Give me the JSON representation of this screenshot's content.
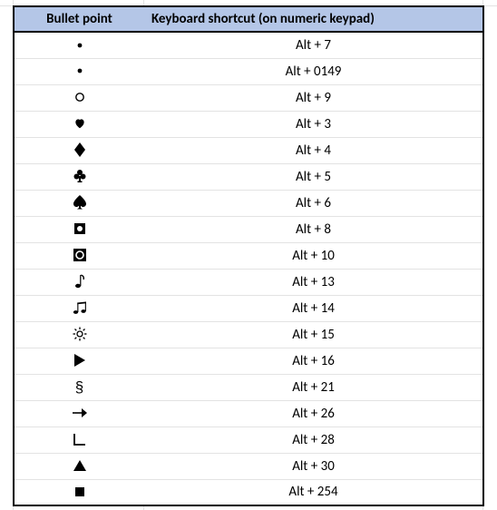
{
  "chart_data": {
    "type": "table",
    "title": "",
    "columns": [
      "Bullet point",
      "Keyboard shortcut (on numeric keypad)"
    ],
    "rows": [
      {
        "symbol_name": "bullet-small",
        "symbol_char": "•",
        "shortcut": "Alt + 7"
      },
      {
        "symbol_name": "bullet-small",
        "symbol_char": "•",
        "shortcut": "Alt + 0149"
      },
      {
        "symbol_name": "circle-outline",
        "symbol_char": "○",
        "shortcut": "Alt + 9"
      },
      {
        "symbol_name": "heart-solid",
        "symbol_char": "♥",
        "shortcut": "Alt + 3"
      },
      {
        "symbol_name": "diamond-solid",
        "symbol_char": "♦",
        "shortcut": "Alt + 4"
      },
      {
        "symbol_name": "club-solid",
        "symbol_char": "♣",
        "shortcut": "Alt + 5"
      },
      {
        "symbol_name": "spade-solid",
        "symbol_char": "♠",
        "shortcut": "Alt + 6"
      },
      {
        "symbol_name": "square-inverse-bullet",
        "symbol_char": "◘",
        "shortcut": "Alt + 8"
      },
      {
        "symbol_name": "square-inverse-circle",
        "symbol_char": "◙",
        "shortcut": "Alt + 10"
      },
      {
        "symbol_name": "eighth-note",
        "symbol_char": "♪",
        "shortcut": "Alt + 13"
      },
      {
        "symbol_name": "beamed-notes",
        "symbol_char": "♫",
        "shortcut": "Alt + 14"
      },
      {
        "symbol_name": "sun-outline",
        "symbol_char": "☼",
        "shortcut": "Alt + 15"
      },
      {
        "symbol_name": "triangle-right",
        "symbol_char": "►",
        "shortcut": "Alt + 16"
      },
      {
        "symbol_name": "section-sign",
        "symbol_char": "§",
        "shortcut": "Alt + 21"
      },
      {
        "symbol_name": "arrow-right",
        "symbol_char": "→",
        "shortcut": "Alt + 26"
      },
      {
        "symbol_name": "right-angle",
        "symbol_char": "∟",
        "shortcut": "Alt + 28"
      },
      {
        "symbol_name": "triangle-up",
        "symbol_char": "▲",
        "shortcut": "Alt + 30"
      },
      {
        "symbol_name": "square-solid-small",
        "symbol_char": "■",
        "shortcut": "Alt + 254"
      }
    ]
  },
  "header": {
    "col1": "Bullet point",
    "col2": "Keyboard shortcut (on numeric keypad)"
  }
}
